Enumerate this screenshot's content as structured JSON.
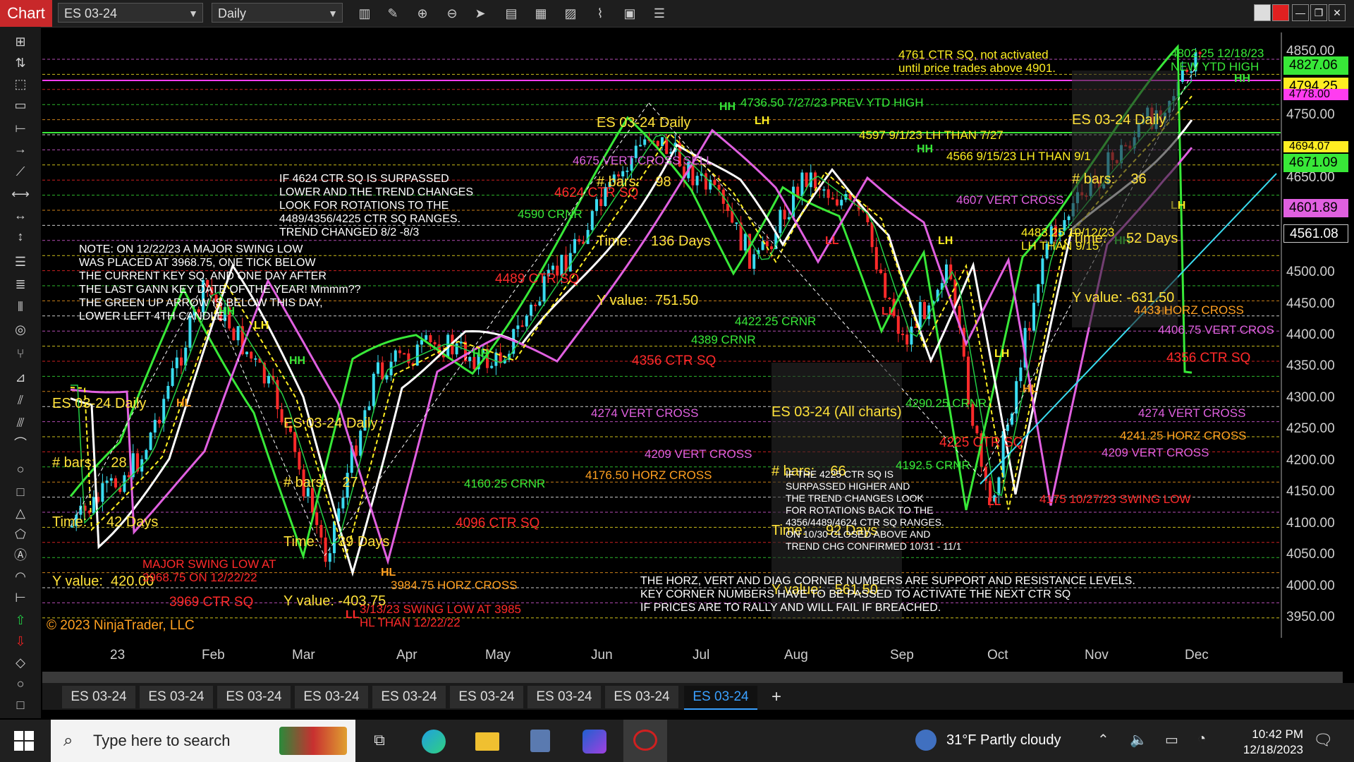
{
  "app": {
    "title": "Chart",
    "instrument": "ES 03-24",
    "interval": "Daily"
  },
  "window_controls": [
    "—",
    "❐",
    "✕"
  ],
  "toolbar_icons": [
    "bar-type-icon",
    "pencil-icon",
    "zoom-in-icon",
    "zoom-out-icon",
    "pointer-icon",
    "data-box-icon",
    "templates-icon",
    "strategies-icon",
    "indicators-icon",
    "properties-icon",
    "list-icon"
  ],
  "y_axis": {
    "labels": [
      "4850.00",
      "4750.00",
      "4650.00",
      "4600.00",
      "4500.00",
      "4450.00",
      "4400.00",
      "4350.00",
      "4300.00",
      "4250.00",
      "4200.00",
      "4150.00",
      "4100.00",
      "4050.00",
      "4000.00",
      "3950.00"
    ]
  },
  "price_tags": [
    {
      "label": "4827.06",
      "color": "#38e838"
    },
    {
      "label": "4794.25",
      "color": "#ffee22"
    },
    {
      "label": "4778.00",
      "color": "#ff3cf0"
    },
    {
      "label": "4694.07",
      "color": "#ffee22"
    },
    {
      "label": "4671.09",
      "color": "#38e838"
    },
    {
      "label": "4601.89",
      "color": "#e060e0"
    },
    {
      "label": "4561.08",
      "color": "#ffffff"
    }
  ],
  "x_axis": {
    "labels": [
      "23",
      "Feb",
      "Mar",
      "Apr",
      "May",
      "Jun",
      "Jul",
      "Aug",
      "Sep",
      "Oct",
      "Nov",
      "Dec"
    ]
  },
  "copyright": "© 2023 NinjaTrader, LLC",
  "info_boxes": [
    {
      "title": "ES 03-24 Daily",
      "bars": "# bars:    98",
      "time": "Time:     136 Days",
      "yvalue": "Y value:  751.50"
    },
    {
      "title": "ES 03-24 Daily",
      "bars": "# bars:    36",
      "time": "Time:     52 Days",
      "yvalue": "Y value: -631.50"
    },
    {
      "title": "ES 03-24 Daily",
      "bars": "# bars:    28",
      "time": "Time:     42 Days",
      "yvalue": "Y value:  420.00"
    },
    {
      "title": "ES 03-24 Daily",
      "bars": "# bars:    27",
      "time": "Time:     39 Days",
      "yvalue": "Y value: -403.75"
    },
    {
      "title": "ES 03-24 (All charts)",
      "bars": "# bars:    66",
      "time": "Time:     92 Days",
      "yvalue": "Y value:  -561.50"
    }
  ],
  "notes": {
    "note_1": "IF 4624 CTR SQ IS SURPASSED\nLOWER AND THE TREND CHANGES\nLOOK FOR ROTATIONS TO THE\n4489/4356/4225 CTR SQ RANGES.\nTREND CHANGED 8/2 -8/3",
    "note_2": "NOTE: ON 12/22/23 A MAJOR SWING LOW\nWAS PLACED AT 3968.75, ONE TICK BELOW\nTHE CURRENT KEY SQ. AND ONE DAY AFTER\nTHE LAST GANN KEY DATE OF THE YEAR! Mmmm??\nTHE GREEN UP ARROW IS BELOW THIS DAY,\nLOWER LEFT 4TH CANDLE.",
    "note_3": "IF THE 4225 CTR SQ IS\nSURPASSED HIGHER AND\nTHE TREND CHANGES LOOK\nFOR ROTATIONS BACK TO THE\n4356/4489/4624 CTR SQ RANGES.\nON 10/30 CLOSED ABOVE AND\nTREND CHG CONFIRMED 10/31 - 11/1",
    "note_4": "THE HORZ, VERT AND DIAG CORNER NUMBERS ARE SUPPORT AND RESISTANCE LEVELS.\nKEY CORNER NUMBERS HAVE TO BE PASSED TO ACTIVATE THE NEXT CTR SQ\nIF PRICES ARE TO RALLY AND WILL FAIL IF BREACHED.",
    "note_5": "4761 CTR SQ, not activated\nuntil price trades above 4901.",
    "note_6": "4802.25 12/18/23\nNEW YTD HIGH",
    "note_7": "MAJOR SWING LOW AT\n3968.75 ON 12/22/22",
    "note_8": "3/13/23 SWING LOW AT 3985\nHL THAN 12/22/22",
    "note_9": "4483.25 10/12/23\nLH THAN 9/15"
  },
  "labels": [
    {
      "text": "4736.50 7/27/23 PREV YTD HIGH",
      "color": "#38e838"
    },
    {
      "text": "4597 9/1/23 LH THAN 7/27",
      "color": "#ffee22"
    },
    {
      "text": "4566 9/15/23 LH THAN 9/1",
      "color": "#ffee22"
    },
    {
      "text": "4675 VERT CROSS SELL",
      "color": "#e060e0"
    },
    {
      "text": "4624 CTR SQ",
      "color": "#ff2a2a"
    },
    {
      "text": "4590 CRNR",
      "color": "#38e838"
    },
    {
      "text": "4607 VERT CROSS",
      "color": "#e060e0"
    },
    {
      "text": "4489 CTR SQ",
      "color": "#ff2a2a"
    },
    {
      "text": "4422.25 CRNR",
      "color": "#38e838"
    },
    {
      "text": "4389 CRNR",
      "color": "#38e838"
    },
    {
      "text": "4356 CTR SQ",
      "color": "#ff2a2a"
    },
    {
      "text": "4274 VERT CROSS",
      "color": "#e060e0"
    },
    {
      "text": "4209 VERT CROSS",
      "color": "#e060e0"
    },
    {
      "text": "4160.25 CRNR",
      "color": "#38e838"
    },
    {
      "text": "4176.50 HORZ CROSS",
      "color": "#ffa020"
    },
    {
      "text": "4096 CTR SQ",
      "color": "#ff2a2a"
    },
    {
      "text": "3984.75 HORZ CROSS",
      "color": "#ffa020"
    },
    {
      "text": "3969 CTR SQ",
      "color": "#ff2a2a"
    },
    {
      "text": "4225 CTR SQ",
      "color": "#ff2a2a"
    },
    {
      "text": "4192.5 CRNR",
      "color": "#38e838"
    },
    {
      "text": "4290.25 CRNR",
      "color": "#38e838"
    },
    {
      "text": "4175 10/27/23 SWING LOW",
      "color": "#ff2a2a"
    },
    {
      "text": "4433 HORZ CROSS",
      "color": "#ffa020"
    },
    {
      "text": "4406.75 VERT CROS",
      "color": "#e060e0"
    },
    {
      "text": "4356 CTR SQ",
      "color": "#ff2a2a"
    },
    {
      "text": "4274 VERT CROSS",
      "color": "#e060e0"
    },
    {
      "text": "4241.25 HORZ CROSS",
      "color": "#ffa020"
    },
    {
      "text": "4209 VERT CROSS",
      "color": "#e060e0"
    }
  ],
  "swing_markers": [
    "HH",
    "LH",
    "HL",
    "LL"
  ],
  "tabs": [
    "ES 03-24",
    "ES 03-24",
    "ES 03-24",
    "ES 03-24",
    "ES 03-24",
    "ES 03-24",
    "ES 03-24",
    "ES 03-24",
    "ES 03-24"
  ],
  "add_tab": "+",
  "taskbar": {
    "search_placeholder": "Type here to search",
    "weather": "31°F  Partly cloudy",
    "time": "10:42 PM",
    "date": "12/18/2023"
  }
}
